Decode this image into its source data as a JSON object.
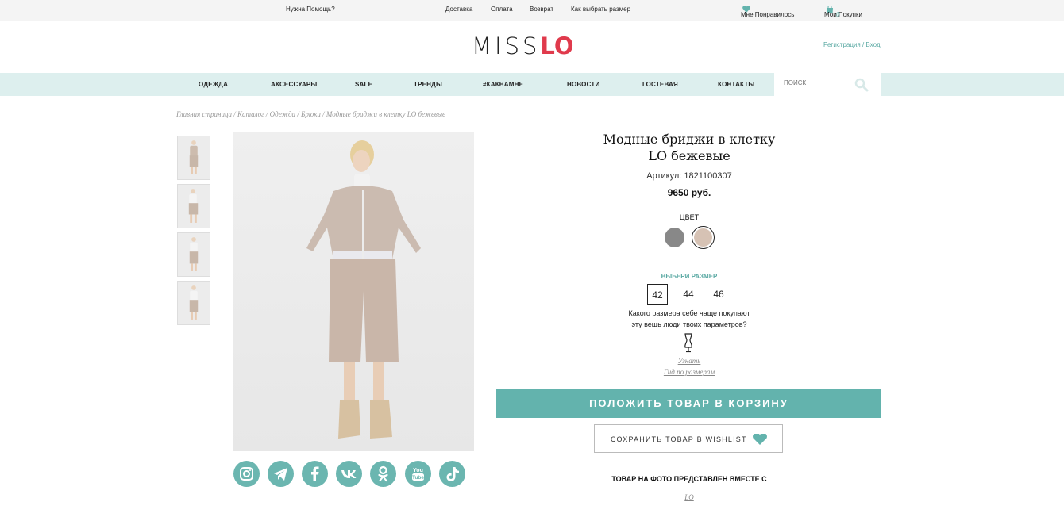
{
  "topbar": {
    "help": "Нужна Помощь?",
    "links": [
      "Доставка",
      "Оплата",
      "Возврат",
      "Как выбрать размер"
    ],
    "favorites": "Мне Понравилось",
    "purchases": "Мои Покупки",
    "cart_count": "0"
  },
  "header": {
    "logo_miss": "MISS",
    "logo_lo": "LO",
    "auth": "Регистрация / Вход"
  },
  "nav": {
    "items": [
      "ОДЕЖДА",
      "АКСЕССУАРЫ",
      "SALE",
      "ТРЕНДЫ",
      "#КАКНАМНЕ",
      "НОВОСТИ",
      "ГОСТЕВАЯ",
      "КОНТАКТЫ"
    ],
    "search_placeholder": "ПОИСК"
  },
  "breadcrumb": "Главная страница / Каталог / Одежда / Брюки / Модные бриджи в клетку LO бежевые",
  "product": {
    "title_line1": "Модные бриджи в клетку",
    "title_line2": "LO бежевые",
    "sku": "Артикул: 1821100307",
    "price": "9650 руб.",
    "color_label": "ЦВЕТ",
    "colors": [
      "#888888",
      "#d6c2b4"
    ],
    "size_label": "ВЫБЕРИ РАЗМЕР",
    "sizes": [
      "42",
      "44",
      "46"
    ],
    "selected_size": "42",
    "size_question_line1": "Какого размера себе чаще покупают",
    "size_question_line2": "эту вещь люди твоих параметров?",
    "learn_link": "Узнать",
    "size_guide_link": "Гид по размерам",
    "add_to_cart": "ПОЛОЖИТЬ ТОВАР В КОРЗИНУ",
    "save_wishlist": "СОХРАНИТЬ ТОВАР В WISHLIST",
    "together_label": "ТОВАР НА ФОТО ПРЕДСТАВЛЕН ВМЕСТЕ С",
    "together_link": "LO"
  },
  "social": [
    "instagram-icon",
    "telegram-icon",
    "facebook-icon",
    "vk-icon",
    "odnoklassniki-icon",
    "youtube-icon",
    "tiktok-icon"
  ],
  "colors": {
    "accent": "#63b3ad",
    "nav_bg": "#ddefee",
    "logo_red": "#e03a4c"
  }
}
